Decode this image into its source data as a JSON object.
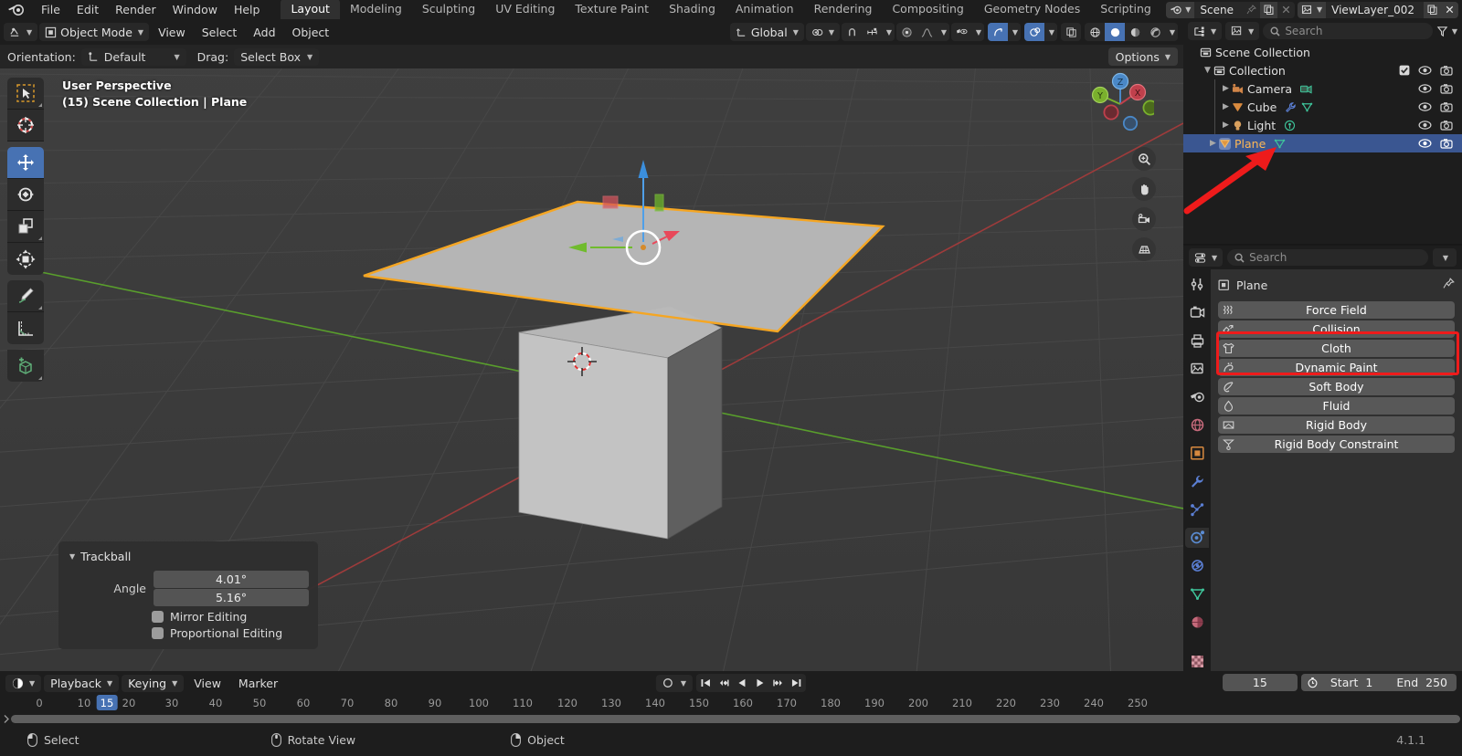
{
  "app": {
    "name": "Blender",
    "version": "4.1.1"
  },
  "topbar": {
    "menus": [
      "File",
      "Edit",
      "Render",
      "Window",
      "Help"
    ],
    "workspaces": [
      {
        "label": "Layout",
        "active": true
      },
      {
        "label": "Modeling",
        "active": false
      },
      {
        "label": "Sculpting",
        "active": false
      },
      {
        "label": "UV Editing",
        "active": false
      },
      {
        "label": "Texture Paint",
        "active": false
      },
      {
        "label": "Shading",
        "active": false
      },
      {
        "label": "Animation",
        "active": false
      },
      {
        "label": "Rendering",
        "active": false
      },
      {
        "label": "Compositing",
        "active": false
      },
      {
        "label": "Geometry Nodes",
        "active": false
      },
      {
        "label": "Scripting",
        "active": false
      }
    ],
    "add_workspace": "+",
    "scene": {
      "name": "Scene"
    },
    "view_layer": {
      "name": "ViewLayer_002"
    }
  },
  "viewport_header": {
    "editor_type_icon": "editor-type-icon",
    "mode": "Object Mode",
    "menus": [
      "View",
      "Select",
      "Add",
      "Object"
    ],
    "transform_orientation": "Global",
    "snap_icon": "magnet-icon",
    "proportional_icon": "proportional-edit-icon"
  },
  "tool_settings": {
    "orientation_label": "Orientation:",
    "orientation_value": "Default",
    "drag_label": "Drag:",
    "drag_value": "Select Box",
    "options_label": "Options"
  },
  "viewport": {
    "perspective": "User Perspective",
    "scene_info": "(15) Scene Collection | Plane",
    "tools": [
      {
        "name": "tweak-select-box-tool",
        "label": "Select Box",
        "active": false
      },
      {
        "name": "cursor-tool",
        "label": "Cursor",
        "active": false
      },
      {
        "name": "move-tool",
        "label": "Move",
        "active": true
      },
      {
        "name": "rotate-tool",
        "label": "Rotate",
        "active": false
      },
      {
        "name": "scale-tool",
        "label": "Scale",
        "active": false
      },
      {
        "name": "transform-tool",
        "label": "Transform",
        "active": false
      },
      {
        "name": "annotate-tool",
        "label": "Annotate",
        "active": false
      },
      {
        "name": "measure-tool",
        "label": "Measure",
        "active": false
      },
      {
        "name": "add-cube-tool",
        "label": "Add Cube",
        "active": false
      }
    ],
    "gizmo_axes": [
      "X",
      "Y",
      "Z"
    ],
    "nav_buttons": [
      "zoom-icon",
      "pan-hand-icon",
      "camera-view-icon",
      "toggle-perspective-icon"
    ]
  },
  "operator_panel": {
    "title": "Trackball",
    "angle_label": "Angle",
    "angle_x": "4.01°",
    "angle_y": "5.16°",
    "mirror_editing": "Mirror Editing",
    "proportional_editing": "Proportional Editing"
  },
  "outliner": {
    "search_placeholder": "Search",
    "rows": [
      {
        "name": "Scene Collection",
        "depth": 0,
        "icon": "collection-icon",
        "type": "scene-collection",
        "disclosure": "",
        "selected": false,
        "checkbox": false,
        "eye": false,
        "camera": false,
        "mods": []
      },
      {
        "name": "Collection",
        "depth": 1,
        "icon": "collection-icon",
        "type": "collection",
        "disclosure": "down",
        "selected": false,
        "checkbox": true,
        "eye": true,
        "camera": true,
        "mods": []
      },
      {
        "name": "Camera",
        "depth": 2,
        "icon": "camera-object-icon",
        "type": "camera",
        "disclosure": "right",
        "selected": false,
        "checkbox": false,
        "eye": true,
        "camera": true,
        "mods": [
          "camera-data-icon"
        ]
      },
      {
        "name": "Cube",
        "depth": 2,
        "icon": "mesh-object-icon",
        "type": "mesh",
        "disclosure": "right",
        "selected": false,
        "checkbox": false,
        "eye": true,
        "camera": true,
        "mods": [
          "wrench-modifier-icon",
          "mesh-data-icon"
        ]
      },
      {
        "name": "Light",
        "depth": 2,
        "icon": "light-object-icon",
        "type": "light",
        "disclosure": "right",
        "selected": false,
        "checkbox": false,
        "eye": true,
        "camera": true,
        "mods": [
          "light-data-icon"
        ]
      },
      {
        "name": "Plane",
        "depth": 2,
        "icon": "mesh-object-icon",
        "type": "mesh",
        "disclosure": "right",
        "selected": true,
        "checkbox": false,
        "eye": true,
        "camera": true,
        "mods": [
          "mesh-data-icon"
        ]
      }
    ]
  },
  "properties": {
    "search_placeholder": "Search",
    "breadcrumb_object": "Plane",
    "tabs": [
      {
        "name": "tool-tab",
        "active": false
      },
      {
        "name": "render-tab",
        "active": false
      },
      {
        "name": "output-tab",
        "active": false
      },
      {
        "name": "view-layer-tab",
        "active": false
      },
      {
        "name": "scene-tab",
        "active": false
      },
      {
        "name": "world-tab",
        "active": false
      },
      {
        "name": "object-tab",
        "active": false
      },
      {
        "name": "modifiers-tab",
        "active": false
      },
      {
        "name": "particles-tab",
        "active": false
      },
      {
        "name": "physics-tab",
        "active": true
      },
      {
        "name": "constraints-tab",
        "active": false
      },
      {
        "name": "data-tab",
        "active": false
      },
      {
        "name": "material-tab",
        "active": false
      },
      {
        "name": "texture-tab",
        "active": false
      }
    ],
    "physics_buttons": [
      {
        "label": "Force Field",
        "icon": "force-field-icon",
        "highlighted": false
      },
      {
        "label": "Collision",
        "icon": "collision-icon",
        "highlighted": true
      },
      {
        "label": "Cloth",
        "icon": "cloth-icon",
        "highlighted": true
      },
      {
        "label": "Dynamic Paint",
        "icon": "dynamic-paint-icon",
        "highlighted": false
      },
      {
        "label": "Soft Body",
        "icon": "soft-body-icon",
        "highlighted": false
      },
      {
        "label": "Fluid",
        "icon": "fluid-icon",
        "highlighted": false
      },
      {
        "label": "Rigid Body",
        "icon": "rigid-body-icon",
        "highlighted": false
      },
      {
        "label": "Rigid Body Constraint",
        "icon": "rigid-body-constraint-icon",
        "highlighted": false
      }
    ]
  },
  "timeline": {
    "menus": [
      "View",
      "Marker"
    ],
    "playback": "Playback",
    "keying": "Keying",
    "current_frame": "15",
    "start_label": "Start",
    "start_value": "1",
    "end_label": "End",
    "end_value": "250",
    "ticks": [
      "0",
      "10",
      "20",
      "30",
      "40",
      "50",
      "60",
      "70",
      "80",
      "90",
      "100",
      "110",
      "120",
      "130",
      "140",
      "150",
      "160",
      "170",
      "180",
      "190",
      "200",
      "210",
      "220",
      "230",
      "240",
      "250"
    ],
    "playhead": "15"
  },
  "statusbar": {
    "items": [
      {
        "icon": "mouse-left-icon",
        "label": "Select"
      },
      {
        "icon": "mouse-middle-icon",
        "label": "Rotate View"
      },
      {
        "icon": "mouse-right-icon",
        "label": "Object"
      }
    ],
    "version": "4.1.1"
  },
  "annotations": {
    "arrow_color": "#ee1b1b",
    "box_color": "#ee1b1b"
  }
}
